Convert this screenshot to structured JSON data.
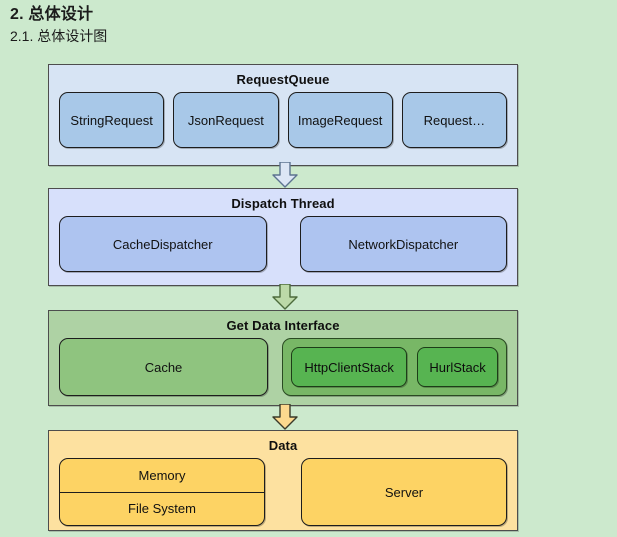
{
  "headings": {
    "main": "2. 总体设计",
    "sub": "2.1. 总体设计图"
  },
  "diagram": {
    "type": "architecture-layer-diagram",
    "colors": {
      "background": "#cce9cd",
      "request_queue_panel": "#d7e4f4",
      "request_queue_node": "#a8c8e8",
      "dispatch_panel": "#d7e0fb",
      "dispatch_node": "#aec4f0",
      "getdata_panel": "#aed2a4",
      "getdata_node": "#8fc47f",
      "getdata_group": "#78b766",
      "getdata_node_dark": "#57b451",
      "data_panel": "#fde1a0",
      "data_node": "#fdd364",
      "border": "#1d1d1d"
    },
    "layers": [
      {
        "id": "request-queue",
        "title": "RequestQueue",
        "nodes": [
          {
            "label": "StringRequest"
          },
          {
            "label": "JsonRequest"
          },
          {
            "label": "ImageRequest"
          },
          {
            "label": "Request…"
          }
        ]
      },
      {
        "id": "dispatch-thread",
        "title": "Dispatch Thread",
        "nodes": [
          {
            "label": "CacheDispatcher"
          },
          {
            "label": "NetworkDispatcher"
          }
        ]
      },
      {
        "id": "get-data-interface",
        "title": "Get Data Interface",
        "nodes": [
          {
            "label": "Cache"
          }
        ],
        "group": {
          "nodes": [
            {
              "label": "HttpClientStack"
            },
            {
              "label": "HurlStack"
            }
          ]
        }
      },
      {
        "id": "data",
        "title": "Data",
        "split_node": {
          "top": "Memory",
          "bottom": "File System"
        },
        "nodes": [
          {
            "label": "Server"
          }
        ]
      }
    ],
    "arrows": [
      {
        "id": "arrow-1",
        "from": "request-queue",
        "to": "dispatch-thread",
        "direction": "down",
        "fill": "#dce6f5",
        "stroke": "#5d7390"
      },
      {
        "id": "arrow-2",
        "from": "dispatch-thread",
        "to": "get-data-interface",
        "direction": "down",
        "fill": "#bcd9a8",
        "stroke": "#4c6b3c"
      },
      {
        "id": "arrow-3",
        "from": "get-data-interface",
        "to": "data",
        "direction": "down",
        "fill": "#fcd98f",
        "stroke": "#3a3a2a"
      }
    ]
  }
}
